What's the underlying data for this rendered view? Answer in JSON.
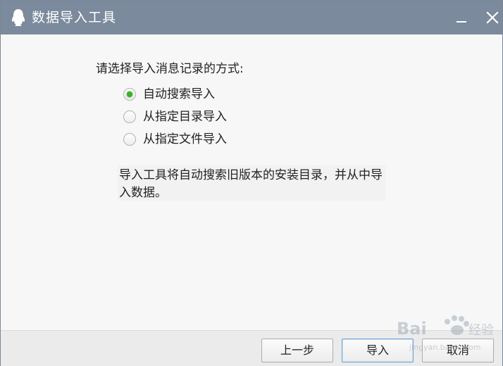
{
  "window": {
    "title": "数据导入工具",
    "title_icon": "qq-penguin-icon",
    "minimize_icon": "minimize-icon",
    "close_icon": "close-icon"
  },
  "main": {
    "prompt": "请选择导入消息记录的方式:",
    "options": [
      {
        "label": "自动搜索导入",
        "selected": true
      },
      {
        "label": "从指定目录导入",
        "selected": false
      },
      {
        "label": "从指定文件导入",
        "selected": false
      }
    ],
    "description": "导入工具将自动搜索旧版本的安装目录，并从中导入数据。"
  },
  "footer": {
    "prev_label": "上一步",
    "import_label": "导入",
    "cancel_label": "取消"
  },
  "colors": {
    "titlebar": "#7b8a9c",
    "radio_selected": "#37b228",
    "primary_border": "#6ea3d6"
  }
}
